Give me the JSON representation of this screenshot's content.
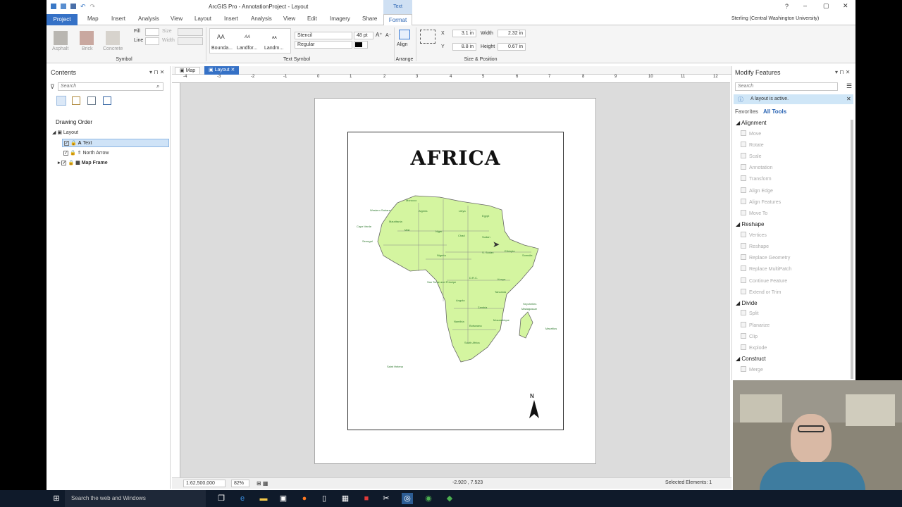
{
  "window": {
    "title": "ArcGIS Pro - AnnotationProject - Layout",
    "context_tab": "Text"
  },
  "ribbon_tabs": [
    "Project",
    "Map",
    "Insert",
    "Analysis",
    "View",
    "Layout",
    "Insert",
    "Analysis",
    "View",
    "Edit",
    "Imagery",
    "Share",
    "Format"
  ],
  "user": "Sterling (Central Washington University)",
  "symbol_group": {
    "label": "Symbol",
    "swatches": [
      "Asphalt",
      "Brick",
      "Concrete"
    ],
    "fill": "Fill",
    "line": "Line",
    "size": "Size",
    "width": "Width"
  },
  "text_symbol_group": {
    "label": "Text Symbol",
    "gallery": [
      "Bounda...",
      "Landfor...",
      "Landm..."
    ],
    "font": "Stencil",
    "font_size": "48 pt",
    "style": "Regular",
    "sample": "AA"
  },
  "arrange_group": {
    "label": "Arrange",
    "align": "Align"
  },
  "size_position": {
    "label": "Size & Position",
    "x_label": "X",
    "x": "3.1 in",
    "y_label": "Y",
    "y": "8.8 in",
    "width_label": "Width",
    "width": "2.32 in",
    "height_label": "Height",
    "height": "0.67 in"
  },
  "contents": {
    "title": "Contents",
    "search_placeholder": "Search",
    "drawing_order": "Drawing Order",
    "layout": "Layout",
    "items": [
      "Text",
      "North Arrow",
      "Map Frame"
    ]
  },
  "view_tabs": [
    "Map",
    "Layout"
  ],
  "ruler": [
    "-4",
    "-3",
    "-2",
    "-1",
    "0",
    "1",
    "2",
    "3",
    "4",
    "5",
    "6",
    "7",
    "8",
    "9",
    "10",
    "11",
    "12"
  ],
  "layout_page": {
    "title": "AFRICA",
    "north": "N"
  },
  "map_labels": [
    "Algeria",
    "Libya",
    "Egypt",
    "Mali",
    "Niger",
    "Chad",
    "Sudan",
    "S. Sudan",
    "Ethiopia",
    "Somalia",
    "Nigeria",
    "Mauritania",
    "Western Sahara",
    "Morocco",
    "Cape Verde",
    "Senegal",
    "Kenya",
    "Tanzania",
    "D.R.C.",
    "Angola",
    "Zambia",
    "Namibia",
    "Botswana",
    "South Africa",
    "Mozambique",
    "Madagascar",
    "Mauritius",
    "Seychelles",
    "Saint Helena",
    "Sao Tome and Principe"
  ],
  "modify": {
    "title": "Modify Features",
    "search_placeholder": "Search",
    "notice": "A layout is active.",
    "favorites": "Favorites",
    "all_tools": "All Tools",
    "sections": [
      {
        "name": "Alignment",
        "tools": [
          "Move",
          "Rotate",
          "Scale",
          "Annotation",
          "Transform",
          "Align Edge",
          "Align Features",
          "Move To"
        ]
      },
      {
        "name": "Reshape",
        "tools": [
          "Vertices",
          "Reshape",
          "Replace Geometry",
          "Replace MultiPatch",
          "Continue Feature",
          "Extend or Trim"
        ]
      },
      {
        "name": "Divide",
        "tools": [
          "Split",
          "Planarize",
          "Clip",
          "Explode"
        ]
      },
      {
        "name": "Construct",
        "tools": [
          "Merge"
        ]
      }
    ]
  },
  "status": {
    "scale": "1:62,500,000",
    "zoom": "82%",
    "coords": "-2.920 , 7.523",
    "selected": "Selected Elements: 1"
  },
  "taskbar": {
    "search": "Search the web and Windows"
  }
}
